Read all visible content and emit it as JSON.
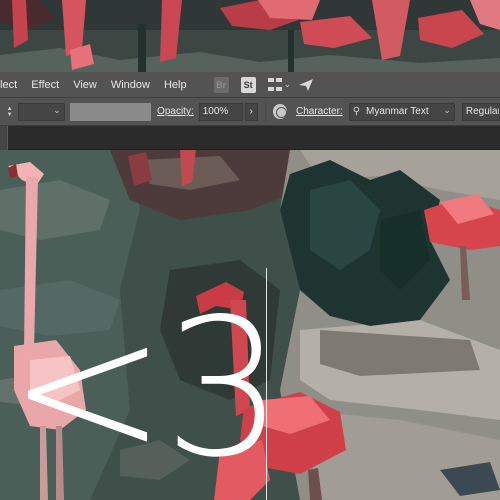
{
  "menubar": {
    "items": [
      "elect",
      "Effect",
      "View",
      "Window",
      "Help"
    ],
    "bridge_icon": "Br",
    "stock_icon": "St",
    "workspace_icon": "grid-icon",
    "sync_icon": "paper-plane-icon"
  },
  "control_bar": {
    "opacity_label": "Opacity:",
    "opacity_value": "100%",
    "character_label": "Character:",
    "font_value": "Myanmar Text",
    "style_value": "Regular",
    "globe_icon": "globe-icon"
  },
  "canvas": {
    "text": "<3"
  },
  "colors": {
    "ui_bar": "#535353",
    "field": "#454545",
    "tab_strip": "#2b2b2b",
    "text_overlay": "#ffffff"
  }
}
